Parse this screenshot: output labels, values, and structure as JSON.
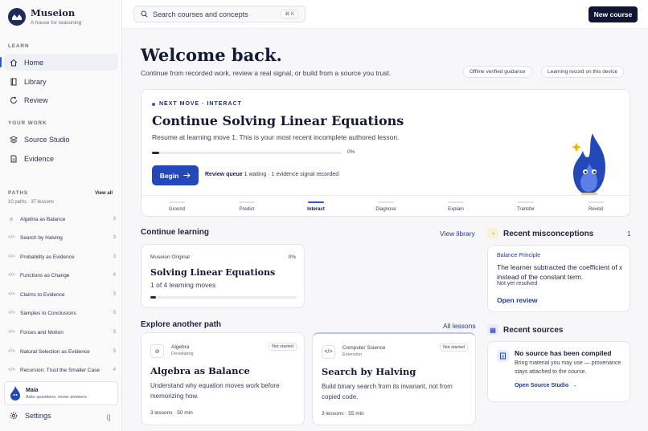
{
  "brand": {
    "name": "Museion",
    "tagline": "A house for reasoning"
  },
  "sidebar": {
    "learn_label": "LEARN",
    "learn_items": [
      {
        "label": "Home",
        "active": true
      },
      {
        "label": "Library",
        "active": false
      },
      {
        "label": "Review",
        "active": false
      }
    ],
    "work_label": "YOUR WORK",
    "work_items": [
      {
        "label": "Source Studio"
      },
      {
        "label": "Evidence"
      }
    ],
    "paths_label": "PATHS",
    "paths_count": "10 paths · 37 lessons",
    "view_all": "View all",
    "paths": [
      {
        "icon": "⊘",
        "label": "Algebra as Balance",
        "count": "3"
      },
      {
        "icon": "</>",
        "label": "Search by Halving",
        "count": "3"
      },
      {
        "icon": "</>",
        "label": "Probability as Evidence",
        "count": "3"
      },
      {
        "icon": "</>",
        "label": "Functions as Change",
        "count": "4"
      },
      {
        "icon": "</>",
        "label": "Claims to Evidence",
        "count": "3"
      },
      {
        "icon": "</>",
        "label": "Samples to Conclusions",
        "count": "3"
      },
      {
        "icon": "</>",
        "label": "Forces and Motion",
        "count": "3"
      },
      {
        "icon": "</>",
        "label": "Natural Selection as Evidence",
        "count": "3"
      },
      {
        "icon": "</>",
        "label": "Recursion: Trust the Smaller Case",
        "count": "4"
      }
    ],
    "assistant": {
      "name": "Maia",
      "subtitle": "Asks questions, never answers"
    },
    "settings": "Settings",
    "collapse": "⟨|"
  },
  "topbar": {
    "search_placeholder": "Search courses and concepts",
    "shortcut": "⌘ K",
    "new_course": "New course"
  },
  "welcome": {
    "title": "Welcome back.",
    "subtitle": "Continue from recorded work, review a real signal, or build from a source you trust.",
    "chips": [
      "Offline verified guidance",
      "Learning record on this device"
    ]
  },
  "hero": {
    "eyebrow": "NEXT MOVE · INTERACT",
    "title": "Continue Solving Linear Equations",
    "subtitle": "Resume at learning move 1. This is your most recent incomplete authored lesson.",
    "progress": 0.04,
    "progress_label": "0%",
    "begin": "Begin",
    "queue_label": "Review queue",
    "queue_detail": "1 waiting · 1 evidence signal recorded",
    "stages": [
      {
        "label": "Ground",
        "current": false
      },
      {
        "label": "Predict",
        "current": false
      },
      {
        "label": "Interact",
        "current": true
      },
      {
        "label": "Diagnose",
        "current": false
      },
      {
        "label": "Explain",
        "current": false
      },
      {
        "label": "Transfer",
        "current": false
      },
      {
        "label": "Revisit",
        "current": false
      }
    ]
  },
  "continue_learning": {
    "title": "Continue learning",
    "view_library": "View library",
    "card": {
      "kicker": "Museion Original",
      "pct": "0%",
      "title": "Solving Linear Equations",
      "subtitle": "1 of 4 learning moves",
      "progress": 0.04
    }
  },
  "explore": {
    "title": "Explore another path",
    "all_lessons": "All lessons",
    "cards": [
      {
        "icon": "⊘",
        "subject": "Algebra",
        "level": "Developing",
        "badge": "Not started",
        "title": "Algebra as Balance",
        "desc": "Understand why equation moves work before memorizing how.",
        "meta": "3 lessons · 50 min"
      },
      {
        "icon": "</>",
        "subject": "Computer Science",
        "level": "Extension",
        "badge": "Not started",
        "title": "Search by Halving",
        "desc": "Build binary search from its invariant, not from copied code.",
        "meta": "3 lessons · 55 min"
      }
    ]
  },
  "misconceptions": {
    "title": "Recent misconceptions",
    "count": "1",
    "tag": "Balance Principle",
    "body": "The learner subtracted the coefficient of x instead of the constant term.",
    "status": "Not yet resolved",
    "open": "Open review"
  },
  "sources": {
    "title": "Recent sources",
    "empty_title": "No source has been compiled",
    "empty_desc": "Bring material you may use — provenance stays attached to the course.",
    "open": "Open Source Studio"
  },
  "colors": {
    "accent": "#2448b8",
    "brand": "#1f2b5e",
    "dark_button": "#0f1533"
  }
}
